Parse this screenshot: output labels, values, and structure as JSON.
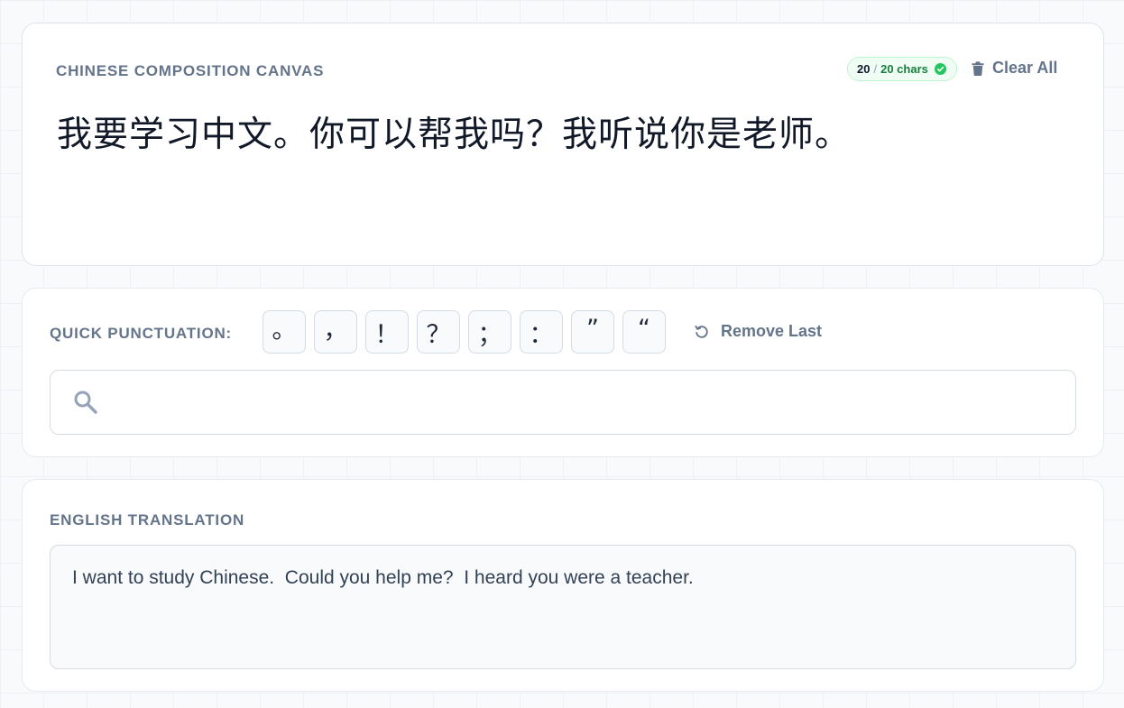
{
  "canvas": {
    "title": "CHINESE COMPOSITION CANVAS",
    "text": "我要学习中文。你可以帮我吗？我听说你是老师。",
    "char_count": "20",
    "char_sep": "/",
    "char_limit": "20 chars",
    "clear_label": "Clear All",
    "badge_color": "#15803d"
  },
  "punctuation": {
    "title": "QUICK PUNCTUATION:",
    "keys": [
      "。",
      "，",
      "！",
      "？",
      "；",
      "：",
      "”",
      "“"
    ],
    "remove_label": "Remove Last"
  },
  "search": {
    "value": "",
    "placeholder": ""
  },
  "translation": {
    "title": "ENGLISH TRANSLATION",
    "text": "I want to study Chinese.  Could you help me?  I heard you were a teacher."
  },
  "icons": {
    "clear": "trash-icon",
    "badge": "check-circle-icon",
    "remove": "undo-icon",
    "search": "search-icon"
  }
}
